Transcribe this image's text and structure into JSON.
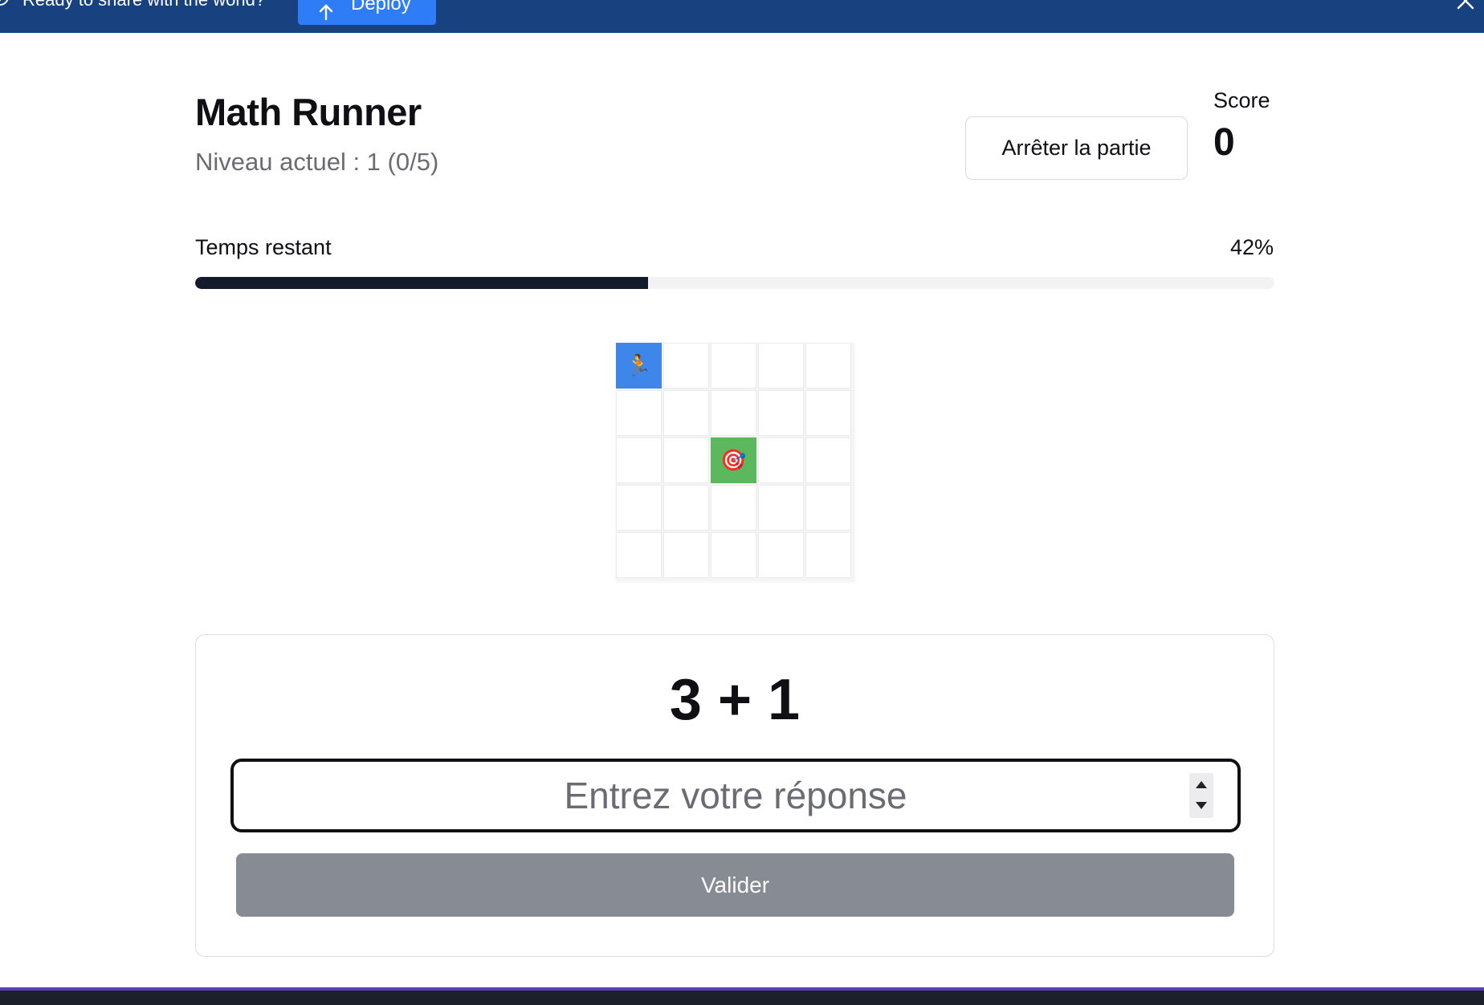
{
  "banner": {
    "text": "Ready to share with the world?",
    "deploy_label": "Deploy",
    "background": "#17427f",
    "button_color": "#2e7cf6"
  },
  "header": {
    "title": "Math Runner",
    "level": "Niveau actuel : 1 (0/5)",
    "stop_label": "Arrêter la partie",
    "score_label": "Score",
    "score_value": "0"
  },
  "timer": {
    "label": "Temps restant",
    "percent_text": "42%",
    "fraction": 0.42
  },
  "grid": {
    "rows": 5,
    "cols": 5,
    "player": {
      "row": 0,
      "col": 0,
      "emoji": "🏃",
      "color": "#3f86eb"
    },
    "target": {
      "row": 2,
      "col": 2,
      "emoji": "🎯",
      "color": "#5cb85c"
    }
  },
  "question": {
    "expression": "3 + 1",
    "input_placeholder": "Entrez votre réponse",
    "input_value": "",
    "submit_label": "Valider"
  }
}
